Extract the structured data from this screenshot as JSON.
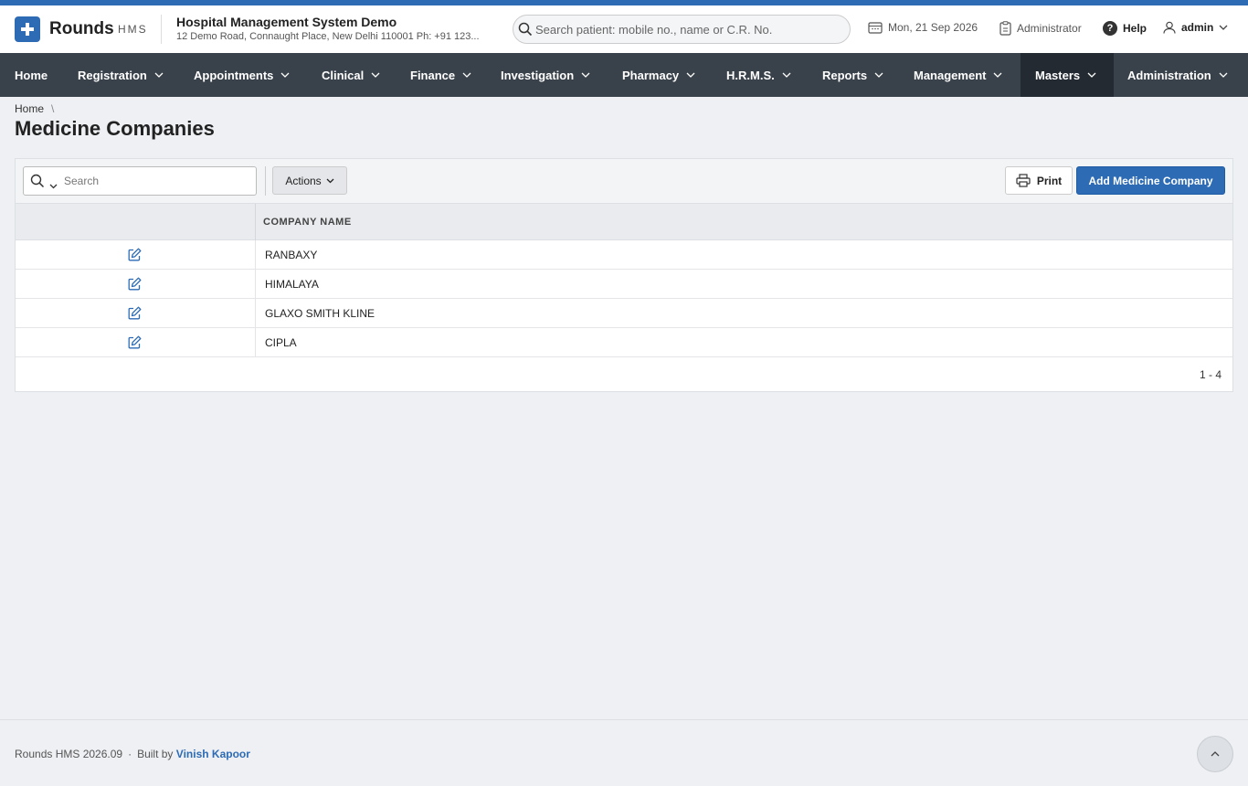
{
  "brand": {
    "name": "Rounds",
    "sub": "HMS"
  },
  "hospital": {
    "name": "Hospital Management System Demo",
    "address": "12 Demo Road, Connaught Place, New Delhi 110001 Ph: +91 123..."
  },
  "global_search": {
    "placeholder": "Search patient: mobile no., name or C.R. No."
  },
  "header": {
    "date": "Mon, 21 Sep 2026",
    "role": "Administrator",
    "help": "Help",
    "user": "admin"
  },
  "nav": {
    "items": [
      {
        "label": "Home"
      },
      {
        "label": "Registration"
      },
      {
        "label": "Appointments"
      },
      {
        "label": "Clinical"
      },
      {
        "label": "Finance"
      },
      {
        "label": "Investigation"
      },
      {
        "label": "Pharmacy"
      },
      {
        "label": "H.R.M.S."
      },
      {
        "label": "Reports"
      },
      {
        "label": "Management"
      },
      {
        "label": "Masters"
      },
      {
        "label": "Administration"
      }
    ],
    "active": "Masters"
  },
  "breadcrumb": {
    "home": "Home",
    "separator": "\\"
  },
  "page": {
    "title": "Medicine Companies"
  },
  "toolbar": {
    "search_placeholder": "Search",
    "actions_label": "Actions",
    "print_label": "Print",
    "add_label": "Add Medicine Company"
  },
  "table": {
    "columns": [
      "COMPANY NAME"
    ],
    "rows": [
      {
        "company_name": "RANBAXY"
      },
      {
        "company_name": "HIMALAYA"
      },
      {
        "company_name": "GLAXO SMITH KLINE"
      },
      {
        "company_name": "CIPLA"
      }
    ],
    "pager": "1 - 4"
  },
  "footer": {
    "version": "Rounds HMS 2026.09",
    "separator": "·",
    "built_by": "Built by",
    "author": "Vinish Kapoor"
  },
  "colors": {
    "brand_blue": "#2d6bb5",
    "nav_bg": "#39424b",
    "nav_active_bg": "#232a31"
  }
}
